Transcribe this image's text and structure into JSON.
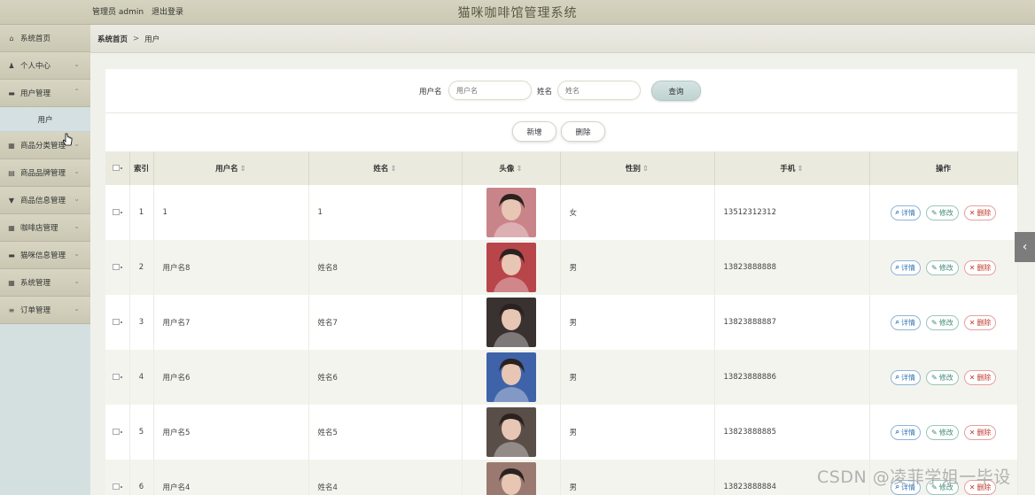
{
  "header": {
    "user_role": "管理员 admin",
    "logout": "退出登录",
    "title": "猫咪咖啡馆管理系统"
  },
  "sidebar": {
    "items": [
      {
        "label": "系统首页",
        "icon": "home-icon",
        "glyph": "⌂",
        "has_children": false
      },
      {
        "label": "个人中心",
        "icon": "person-icon",
        "glyph": "♟",
        "has_children": true,
        "chevron": "down"
      },
      {
        "label": "用户管理",
        "icon": "users-icon",
        "glyph": "▬",
        "has_children": true,
        "chevron": "up"
      },
      {
        "label": "商品分类管理",
        "icon": "grid-icon",
        "glyph": "▦",
        "has_children": true,
        "chevron": "down"
      },
      {
        "label": "商品品牌管理",
        "icon": "tag-icon",
        "glyph": "▤",
        "has_children": true,
        "chevron": "down"
      },
      {
        "label": "商品信息管理",
        "icon": "info-icon",
        "glyph": "▼",
        "has_children": true,
        "chevron": "down"
      },
      {
        "label": "咖啡店管理",
        "icon": "store-icon",
        "glyph": "▦",
        "has_children": true,
        "chevron": "down"
      },
      {
        "label": "猫咪信息管理",
        "icon": "cat-icon",
        "glyph": "▬",
        "has_children": true,
        "chevron": "down"
      },
      {
        "label": "系统管理",
        "icon": "settings-icon",
        "glyph": "▦",
        "has_children": true,
        "chevron": "down"
      },
      {
        "label": "订单管理",
        "icon": "list-icon",
        "glyph": "≡",
        "has_children": true,
        "chevron": "down"
      }
    ],
    "submenu_user": "用户"
  },
  "breadcrumb": {
    "home": "系统首页",
    "separator": ">",
    "current": "用户"
  },
  "search": {
    "username_label": "用户名",
    "username_placeholder": "用户名",
    "name_label": "姓名",
    "name_placeholder": "姓名",
    "query_button": "查询"
  },
  "actions": {
    "add_button": "新增",
    "delete_button": "删除"
  },
  "table": {
    "headers": {
      "index": "索引",
      "username": "用户名",
      "name": "姓名",
      "avatar": "头像",
      "gender": "性别",
      "phone": "手机",
      "ops": "操作"
    },
    "sort_icon": "⇕",
    "op_labels": {
      "detail": "详情",
      "edit": "修改",
      "delete": "删除"
    },
    "rows": [
      {
        "index": "1",
        "username": "1",
        "name": "1",
        "gender": "女",
        "phone": "13512312312",
        "avatar_color": "#c9848a"
      },
      {
        "index": "2",
        "username": "用户名8",
        "name": "姓名8",
        "gender": "男",
        "phone": "13823888888",
        "avatar_color": "#b8454a"
      },
      {
        "index": "3",
        "username": "用户名7",
        "name": "姓名7",
        "gender": "男",
        "phone": "13823888887",
        "avatar_color": "#3a3230"
      },
      {
        "index": "4",
        "username": "用户名6",
        "name": "姓名6",
        "gender": "男",
        "phone": "13823888886",
        "avatar_color": "#3f63a8"
      },
      {
        "index": "5",
        "username": "用户名5",
        "name": "姓名5",
        "gender": "男",
        "phone": "13823888885",
        "avatar_color": "#5a4e48"
      },
      {
        "index": "6",
        "username": "用户名4",
        "name": "姓名4",
        "gender": "男",
        "phone": "13823888884",
        "avatar_color": "#9a7a70"
      }
    ]
  },
  "watermark": "CSDN @凌菲学姐一毕设",
  "colors": {
    "header_bg": "#cfcdb8",
    "sidebar_bg": "#d4dfe0",
    "table_header_bg": "#ebeadf",
    "detail": "#3a78b5",
    "edit": "#3d8a76",
    "delete": "#c0392b"
  }
}
